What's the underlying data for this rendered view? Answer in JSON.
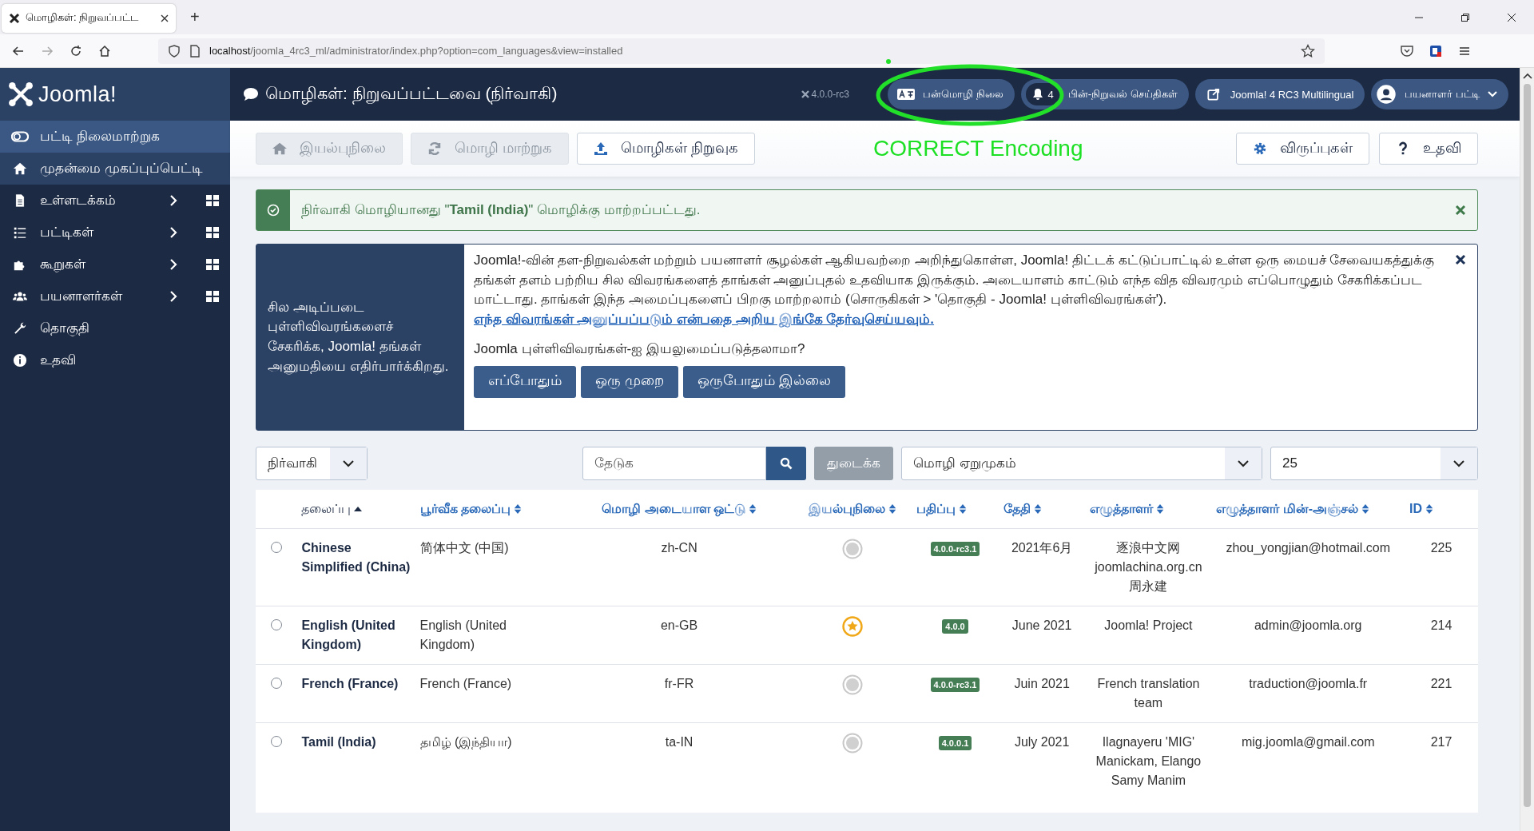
{
  "browser": {
    "tab_title": "மொழிகள்: நிறுவப்பட்ட",
    "new_tab": "+",
    "url_host": "localhost",
    "url_path": "/joomla_4rc3_ml/administrator/index.php?option=com_languages&view=installed"
  },
  "sidebar": {
    "logo": "Joomla!",
    "toggle": "பட்டி நிலைமாற்றுக",
    "items": [
      {
        "label": "முதன்மை முகப்புப்பெட்டி",
        "selected": true,
        "has_submenu": false
      },
      {
        "label": "உள்ளடக்கம்",
        "selected": false,
        "has_submenu": true
      },
      {
        "label": "பட்டிகள்",
        "selected": false,
        "has_submenu": true
      },
      {
        "label": "கூறுகள்",
        "selected": false,
        "has_submenu": true
      },
      {
        "label": "பயனாளர்கள்",
        "selected": false,
        "has_submenu": true
      },
      {
        "label": "தொகுதி",
        "selected": false,
        "has_submenu": false
      },
      {
        "label": "உதவி",
        "selected": false,
        "has_submenu": false
      }
    ]
  },
  "header": {
    "title": "மொழிகள்: நிறுவப்பட்டவை (நிர்வாகி)",
    "version": "4.0.0-rc3",
    "pills": [
      {
        "label": "பன்மொழி நிலை"
      },
      {
        "label": "பின்-நிறுவல் செய்திகள்",
        "count": "4"
      },
      {
        "label": "Joomla! 4 RC3 Multilingual"
      },
      {
        "label": "பயனாளர் பட்டி",
        "dropdown": true
      }
    ]
  },
  "toolbar": {
    "buttons": [
      {
        "label": "இயல்புநிலை",
        "disabled": true
      },
      {
        "label": "மொழி மாற்றுக",
        "disabled": true
      },
      {
        "label": "மொழிகள் நிறுவுக",
        "disabled": false
      }
    ],
    "right_buttons": [
      {
        "label": "விருப்புகள்"
      },
      {
        "label": "உதவி"
      }
    ]
  },
  "annotation": {
    "text": "CORRECT Encoding"
  },
  "alert": {
    "message": "நிர்வாகி மொழியானது \"**Tamil (India)**\" மொழிக்கு மாற்றப்பட்டது."
  },
  "stats": {
    "side_text": "சில அடிப்படை புள்ளிவிவரங்களைச் சேகரிக்க, Joomla! தங்கள் அனுமதியை எதிர்பார்க்கிறது.",
    "text": "Joomla!-வின் தள-நிறுவல்கள் மற்றும் பயனாளர் சூழல்கள் ஆகியவற்றை அறிந்துகொள்ள, Joomla! திட்டக் கட்டுப்பாட்டில் உள்ள ஒரு மையச் சேவையகத்துக்கு தங்கள் தளம் பற்றிய சில விவரங்களைத் தாங்கள் அனுப்புதல் உதவியாக இருக்கும். அடையாளம் காட்டும் எந்த வித விவரமும் எப்பொழுதும் சேகரிக்கப்பட மாட்டாது. தாங்கள் இந்த அமைப்புகளைப் பிறகு மாற்றலாம் (சொருகிகள் > 'தொகுதி - Joomla! புள்ளிவிவரங்கள்').",
    "link": "எந்த விவரங்கள் அனுப்பப்படும் என்பதை அறிய இங்கே தேர்வுசெய்யவும்.",
    "question": "Joomla புள்ளிவிவரங்கள்-ஐ இயலுமைப்படுத்தலாமா?",
    "buttons": [
      "எப்போதும்",
      "ஒரு முறை",
      "ஒருபோதும் இல்லை"
    ]
  },
  "filters": {
    "client": "நிர்வாகி",
    "search_placeholder": "தேடுக",
    "clear": "துடைக்க",
    "ordering": "மொழி ஏறுமுகம்",
    "limit": "25"
  },
  "table": {
    "columns": [
      {
        "label": "தலைப்பு",
        "sorted": true
      },
      {
        "label": "பூர்வீக தலைப்பு",
        "sorted": false
      },
      {
        "label": "மொழி அடையாள ஒட்டு",
        "sorted": false
      },
      {
        "label": "இயல்புநிலை",
        "sorted": false
      },
      {
        "label": "பதிப்பு",
        "sorted": false
      },
      {
        "label": "தேதி",
        "sorted": false
      },
      {
        "label": "எழுத்தாளர்",
        "sorted": false
      },
      {
        "label": "எழுத்தாளர் மின்-அஞ்சல்",
        "sorted": false
      },
      {
        "label": "ID",
        "sorted": false
      }
    ],
    "rows": [
      {
        "selected": false,
        "title": "Chinese Simplified (China)",
        "native": "简体中文 (中国)",
        "code": "zh-CN",
        "default": false,
        "version": "4.0.0-rc3.1",
        "date": "2021年6月",
        "author": "逐浪中文网 joomlachina.org.cn 周永建",
        "email": "zhou_yongjian@hotmail.com",
        "id": "225"
      },
      {
        "selected": false,
        "title": "English (United Kingdom)",
        "native": "English (United Kingdom)",
        "code": "en-GB",
        "default": true,
        "version": "4.0.0",
        "date": "June 2021",
        "author": "Joomla! Project",
        "email": "admin@joomla.org",
        "id": "214"
      },
      {
        "selected": false,
        "title": "French (France)",
        "native": "French (France)",
        "code": "fr-FR",
        "default": false,
        "version": "4.0.0-rc3.1",
        "date": "Juin 2021",
        "author": "French translation team",
        "email": "traduction@joomla.fr",
        "id": "221"
      },
      {
        "selected": false,
        "title": "Tamil (India)",
        "native": "தமிழ் (இந்தியா)",
        "code": "ta-IN",
        "default": false,
        "version": "4.0.0.1",
        "date": "July 2021",
        "author": "Ilagnayeru 'MIG' Manickam, Elango Samy Manim",
        "email": "mig.joomla@gmail.com",
        "id": "217"
      }
    ]
  }
}
